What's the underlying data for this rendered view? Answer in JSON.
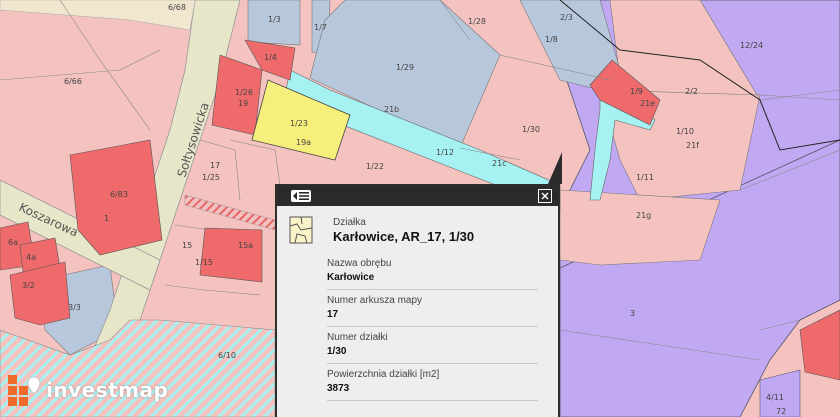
{
  "map": {
    "street_labels": {
      "soltysowicka": "Sołtysowicka",
      "koszarowa": "Koszarowa"
    },
    "parcel_labels": [
      "6/68",
      "1/3",
      "1/7",
      "1/28",
      "2/3",
      "12/24",
      "1/8",
      "1/4",
      "1/29",
      "6/66",
      "1/26",
      "19",
      "21b",
      "1/9",
      "21e",
      "2/2",
      "1/23",
      "19a",
      "1/30",
      "1/10",
      "21f",
      "1/12",
      "21c",
      "17",
      "1/25",
      "1/22",
      "1/11",
      "6/83",
      "1",
      "21g",
      "15",
      "15a",
      "6a",
      "4a",
      "1/15",
      "3/2",
      "3/3",
      "3",
      "6/10",
      "4/11",
      "72"
    ],
    "colors": {
      "residential": "#f4c3c0",
      "built": "#ef6b6b",
      "selected": "#f7ef7c",
      "industrial": "#c1a8f2",
      "public": "#b8c8dc",
      "road_water": "#a6f2f2",
      "road": "#e8e6c8"
    }
  },
  "popup": {
    "icons": {
      "menu": "list-menu-icon",
      "close": "close-icon",
      "parcel": "parcel-map-icon"
    },
    "header_label": "Działka",
    "header_value": "Karłowice, AR_17, 1/30",
    "fields": [
      {
        "label": "Nazwa obrębu",
        "value": "Karłowice"
      },
      {
        "label": "Numer arkusza mapy",
        "value": "17"
      },
      {
        "label": "Numer działki",
        "value": "1/30"
      },
      {
        "label": "Powierzchnia działki [m2]",
        "value": "3873"
      }
    ]
  },
  "logo": {
    "text": "investmap",
    "accent": "#f06a2a"
  }
}
